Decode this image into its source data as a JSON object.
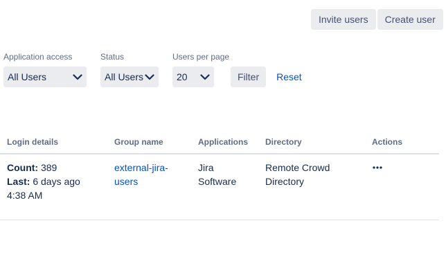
{
  "header": {
    "invite_label": "Invite users",
    "create_label": "Create user"
  },
  "filters": {
    "application_access": {
      "label": "Application access",
      "value": "All Users"
    },
    "status": {
      "label": "Status",
      "value": "All Users"
    },
    "per_page": {
      "label": "Users per page",
      "value": "20"
    },
    "filter_label": "Filter",
    "reset_label": "Reset"
  },
  "table": {
    "columns": [
      "Login details",
      "Group name",
      "Applications",
      "Directory",
      "Actions"
    ],
    "rows": [
      {
        "count_label": "Count:",
        "count_value": "389",
        "last_label": "Last:",
        "last_value": "6 days ago 4:38 AM",
        "group": "external-jira-users",
        "application": "Jira Software",
        "directory": "Remote Crowd Directory",
        "actions_icon": "more-horizontal-icon"
      }
    ]
  },
  "colors": {
    "button_bg": "#ebecf0",
    "link": "#0052cc",
    "text": "#172b4d",
    "muted": "#5e6c84",
    "border": "#dfe1e6"
  }
}
